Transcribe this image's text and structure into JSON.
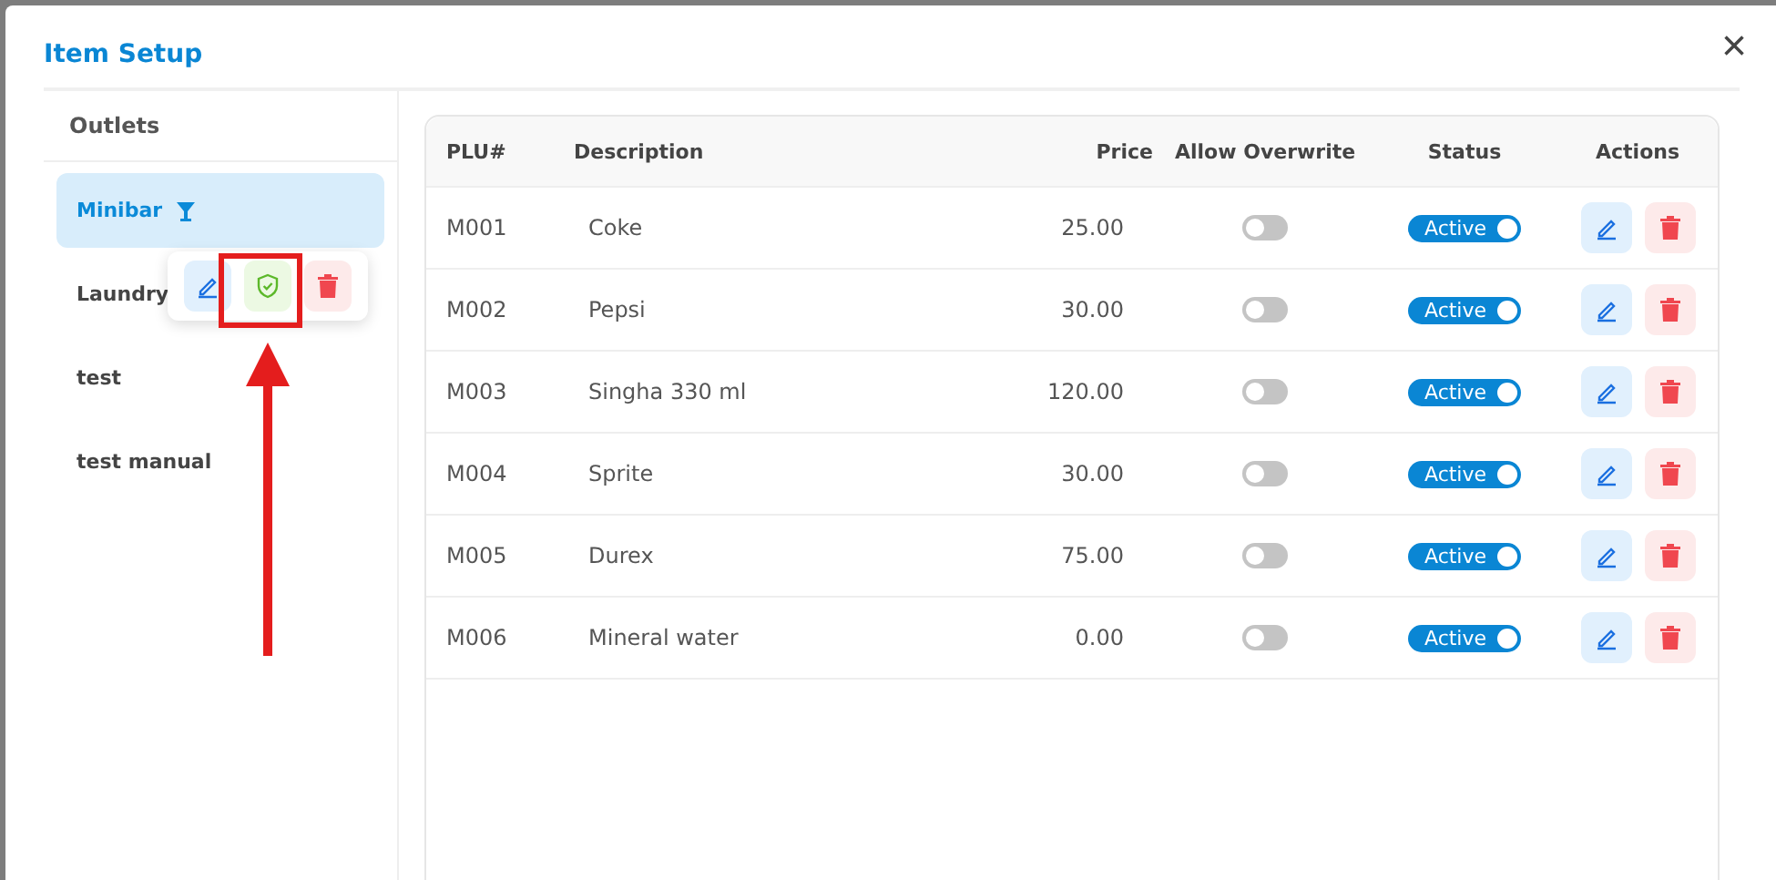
{
  "dialog": {
    "title": "Item Setup",
    "close": "×"
  },
  "outlets": {
    "heading": "Outlets",
    "items": [
      {
        "name": "Minibar",
        "selected": true,
        "kind": "bar"
      },
      {
        "name": "Laundry",
        "selected": false,
        "kind": "plain"
      },
      {
        "name": "test",
        "selected": false,
        "kind": "plain"
      },
      {
        "name": "test manual",
        "selected": false,
        "kind": "plain"
      }
    ]
  },
  "popover": {
    "actions": [
      {
        "kind": "edit"
      },
      {
        "kind": "verify"
      },
      {
        "kind": "delete"
      }
    ]
  },
  "annotation": {
    "kind": "box-arrow"
  },
  "table": {
    "columns": [
      "PLU#",
      "Description",
      "Price",
      "Allow Overwrite",
      "Status",
      "Actions"
    ],
    "rows": [
      {
        "plu": "M001",
        "description": "Coke",
        "price": "25.00",
        "allow_overwrite": false,
        "status": "Active",
        "active": true
      },
      {
        "plu": "M002",
        "description": "Pepsi",
        "price": "30.00",
        "allow_overwrite": false,
        "status": "Active",
        "active": true
      },
      {
        "plu": "M003",
        "description": "Singha 330 ml",
        "price": "120.00",
        "allow_overwrite": false,
        "status": "Active",
        "active": true
      },
      {
        "plu": "M004",
        "description": "Sprite",
        "price": "30.00",
        "allow_overwrite": false,
        "status": "Active",
        "active": true
      },
      {
        "plu": "M005",
        "description": "Durex",
        "price": "75.00",
        "allow_overwrite": false,
        "status": "Active",
        "active": true
      },
      {
        "plu": "M006",
        "description": "Mineral water",
        "price": "0.00",
        "allow_overwrite": false,
        "status": "Active",
        "active": true
      }
    ]
  }
}
